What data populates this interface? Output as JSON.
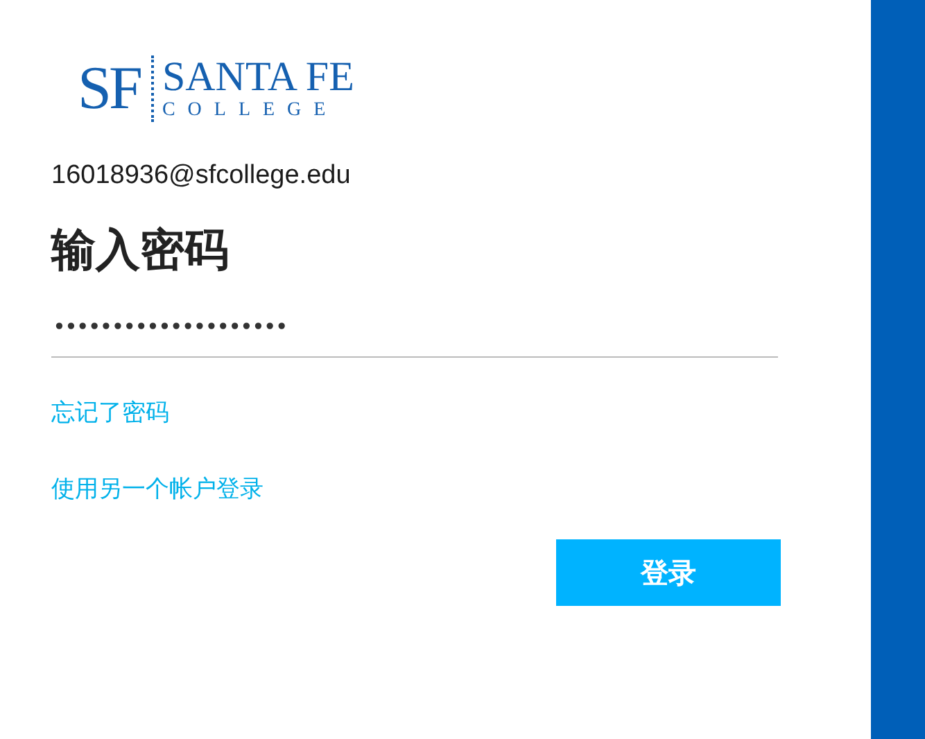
{
  "logo": {
    "monogram": "SF",
    "name": "SANTA FE",
    "subtitle": "COLLEGE"
  },
  "account": "16018936@sfcollege.edu",
  "title": "输入密码",
  "password": {
    "value": "••••••••••••••••••••"
  },
  "links": [
    "忘记了密码",
    "使用另一个帐户登录"
  ],
  "button": "登录"
}
